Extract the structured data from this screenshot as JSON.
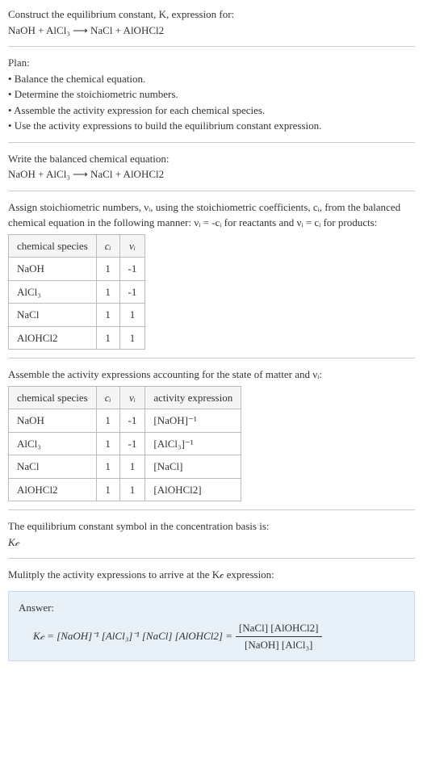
{
  "header": {
    "line1": "Construct the equilibrium constant, K, expression for:",
    "equation": "NaOH + AlCl₃  ⟶  NaCl + AlOHCl2"
  },
  "plan": {
    "title": "Plan:",
    "items": [
      "• Balance the chemical equation.",
      "• Determine the stoichiometric numbers.",
      "• Assemble the activity expression for each chemical species.",
      "• Use the activity expressions to build the equilibrium constant expression."
    ]
  },
  "balanced": {
    "title": "Write the balanced chemical equation:",
    "equation": "NaOH + AlCl₃  ⟶  NaCl + AlOHCl2"
  },
  "stoich": {
    "intro": "Assign stoichiometric numbers, νᵢ, using the stoichiometric coefficients, cᵢ, from the balanced chemical equation in the following manner: νᵢ = -cᵢ for reactants and νᵢ = cᵢ for products:",
    "headers": [
      "chemical species",
      "cᵢ",
      "νᵢ"
    ],
    "rows": [
      {
        "species": "NaOH",
        "c": "1",
        "v": "-1"
      },
      {
        "species": "AlCl₃",
        "c": "1",
        "v": "-1"
      },
      {
        "species": "NaCl",
        "c": "1",
        "v": "1"
      },
      {
        "species": "AlOHCl2",
        "c": "1",
        "v": "1"
      }
    ]
  },
  "activity": {
    "intro": "Assemble the activity expressions accounting for the state of matter and νᵢ:",
    "headers": [
      "chemical species",
      "cᵢ",
      "νᵢ",
      "activity expression"
    ],
    "rows": [
      {
        "species": "NaOH",
        "c": "1",
        "v": "-1",
        "expr": "[NaOH]⁻¹"
      },
      {
        "species": "AlCl₃",
        "c": "1",
        "v": "-1",
        "expr": "[AlCl₃]⁻¹"
      },
      {
        "species": "NaCl",
        "c": "1",
        "v": "1",
        "expr": "[NaCl]"
      },
      {
        "species": "AlOHCl2",
        "c": "1",
        "v": "1",
        "expr": "[AlOHCl2]"
      }
    ]
  },
  "symbol": {
    "line1": "The equilibrium constant symbol in the concentration basis is:",
    "line2": "K𝒸"
  },
  "multiply": {
    "text": "Mulitply the activity expressions to arrive at the K𝒸 expression:"
  },
  "answer": {
    "label": "Answer:",
    "lhs": "K𝒸 = [NaOH]⁻¹ [AlCl₃]⁻¹ [NaCl] [AlOHCl2] =",
    "num": "[NaCl] [AlOHCl2]",
    "den": "[NaOH] [AlCl₃]"
  },
  "chart_data": {
    "type": "table",
    "tables": [
      {
        "title": "Stoichiometric numbers",
        "columns": [
          "chemical species",
          "c_i",
          "ν_i"
        ],
        "rows": [
          [
            "NaOH",
            1,
            -1
          ],
          [
            "AlCl3",
            1,
            -1
          ],
          [
            "NaCl",
            1,
            1
          ],
          [
            "AlOHCl2",
            1,
            1
          ]
        ]
      },
      {
        "title": "Activity expressions",
        "columns": [
          "chemical species",
          "c_i",
          "ν_i",
          "activity expression"
        ],
        "rows": [
          [
            "NaOH",
            1,
            -1,
            "[NaOH]^-1"
          ],
          [
            "AlCl3",
            1,
            -1,
            "[AlCl3]^-1"
          ],
          [
            "NaCl",
            1,
            1,
            "[NaCl]"
          ],
          [
            "AlOHCl2",
            1,
            1,
            "[AlOHCl2]"
          ]
        ]
      }
    ],
    "equilibrium_constant": "K_c = ([NaCl][AlOHCl2]) / ([NaOH][AlCl3])"
  }
}
